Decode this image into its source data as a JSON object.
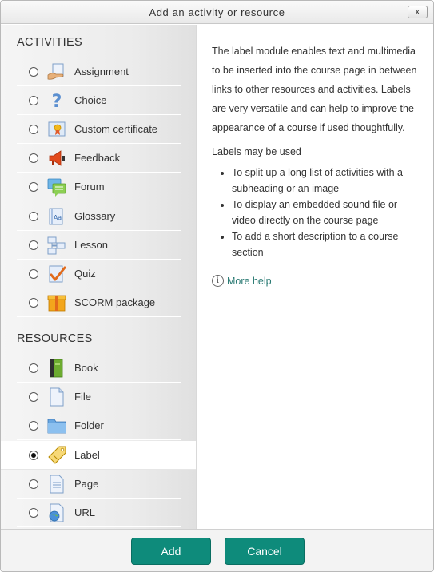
{
  "dialog": {
    "title": "Add an activity or resource",
    "close_label": "x"
  },
  "activities": {
    "heading": "ACTIVITIES",
    "items": [
      {
        "label": "Assignment",
        "icon": "assignment-icon"
      },
      {
        "label": "Choice",
        "icon": "choice-icon"
      },
      {
        "label": "Custom certificate",
        "icon": "certificate-icon"
      },
      {
        "label": "Feedback",
        "icon": "feedback-icon"
      },
      {
        "label": "Forum",
        "icon": "forum-icon"
      },
      {
        "label": "Glossary",
        "icon": "glossary-icon"
      },
      {
        "label": "Lesson",
        "icon": "lesson-icon"
      },
      {
        "label": "Quiz",
        "icon": "quiz-icon"
      },
      {
        "label": "SCORM package",
        "icon": "scorm-icon"
      }
    ]
  },
  "resources": {
    "heading": "RESOURCES",
    "items": [
      {
        "label": "Book",
        "icon": "book-icon"
      },
      {
        "label": "File",
        "icon": "file-icon"
      },
      {
        "label": "Folder",
        "icon": "folder-icon"
      },
      {
        "label": "Label",
        "icon": "label-icon",
        "selected": true
      },
      {
        "label": "Page",
        "icon": "page-icon"
      },
      {
        "label": "URL",
        "icon": "url-icon"
      }
    ]
  },
  "help": {
    "description": "The label module enables text and multimedia to be inserted into the course page in between links to other resources and activities. Labels are very versatile and can help to improve the appearance of a course if used thoughtfully.",
    "used_heading": "Labels may be used",
    "bullets": [
      "To split up a long list of activities with a subheading or an image",
      "To display an embedded sound file or video directly on the course page",
      "To add a short description to a course section"
    ],
    "more_help": "More help"
  },
  "footer": {
    "add_label": "Add",
    "cancel_label": "Cancel"
  },
  "colors": {
    "accent": "#0e8b7b",
    "link": "#2a7a73"
  }
}
